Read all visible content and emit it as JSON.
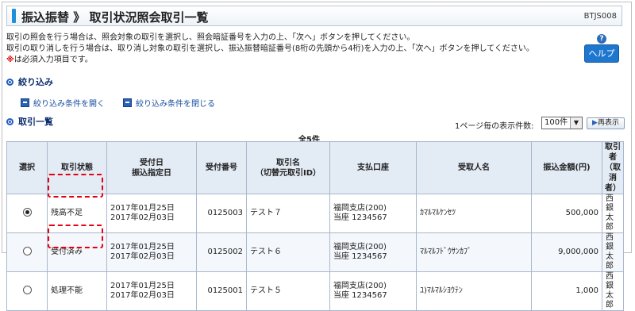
{
  "header": {
    "title": "振込振替 》 取引状況照会取引一覧",
    "screen_code": "BTJS008"
  },
  "info": {
    "line1": "取引の照会を行う場合は、照会対象の取引を選択し、照会暗証番号を入力の上、「次へ」ボタンを押してください。",
    "line2": "取引の取り消しを行う場合は、取り消し対象の取引を選択し、振込振替暗証番号(8桁の先頭から4桁)を入力の上、「次へ」ボタンを押してください。",
    "required_mark": "※",
    "required_text": "は必須入力項目です。"
  },
  "help": {
    "label": "ヘルプ",
    "icon": "question-icon"
  },
  "filter": {
    "heading": "絞り込み",
    "open_link": "絞り込み条件を開く",
    "close_link": "絞り込み条件を閉じる"
  },
  "list": {
    "heading": "取引一覧",
    "perpage_label": "1ページ毎の表示件数:",
    "perpage_value": "100件",
    "redisplay": "再表示",
    "total": "全5件",
    "columns": {
      "select": "選択",
      "status": "取引状態",
      "date1": "受付日",
      "date2": "振込指定日",
      "number": "受付番号",
      "name1": "取引名",
      "name2": "（切替元取引ID）",
      "account": "支払口座",
      "payee": "受取人名",
      "amount": "振込金額(円)",
      "user1": "取引者",
      "user2": "（取消者）"
    },
    "rows": [
      {
        "selected": true,
        "status": "残高不足",
        "date1": "2017年01月25日",
        "date2": "2017年02月03日",
        "number": "0125003",
        "name": "テスト７",
        "account1": "福岡支店(200)",
        "account2": "当座 1234567",
        "payee": "ｶﾏﾙﾏﾙｹﾝｾﾂ",
        "amount": "500,000",
        "user": "西銀太郎"
      },
      {
        "selected": false,
        "status": "受付済み",
        "date1": "2017年01月25日",
        "date2": "2017年02月03日",
        "number": "0125002",
        "name": "テスト６",
        "account1": "福岡支店(200)",
        "account2": "当座 1234567",
        "payee": "ﾏﾙﾏﾙﾌﾄﾞｳｻﾝｶﾌﾞ",
        "amount": "9,000,000",
        "user": "西銀太郎"
      },
      {
        "selected": false,
        "status": "処理不能",
        "date1": "2017年01月25日",
        "date2": "2017年02月03日",
        "number": "0125001",
        "name": "テスト５",
        "account1": "福岡支店(200)",
        "account2": "当座 1234567",
        "payee": "ﾕ)ﾏﾙﾏﾙｼﾖｳﾃﾝ",
        "amount": "1,000",
        "user": "西銀太郎"
      }
    ]
  },
  "colors": {
    "accent": "#1f8fd6",
    "highlight": "#e60012",
    "header_bg": "#e3ebf5",
    "help_bg": "#1e77cf"
  }
}
